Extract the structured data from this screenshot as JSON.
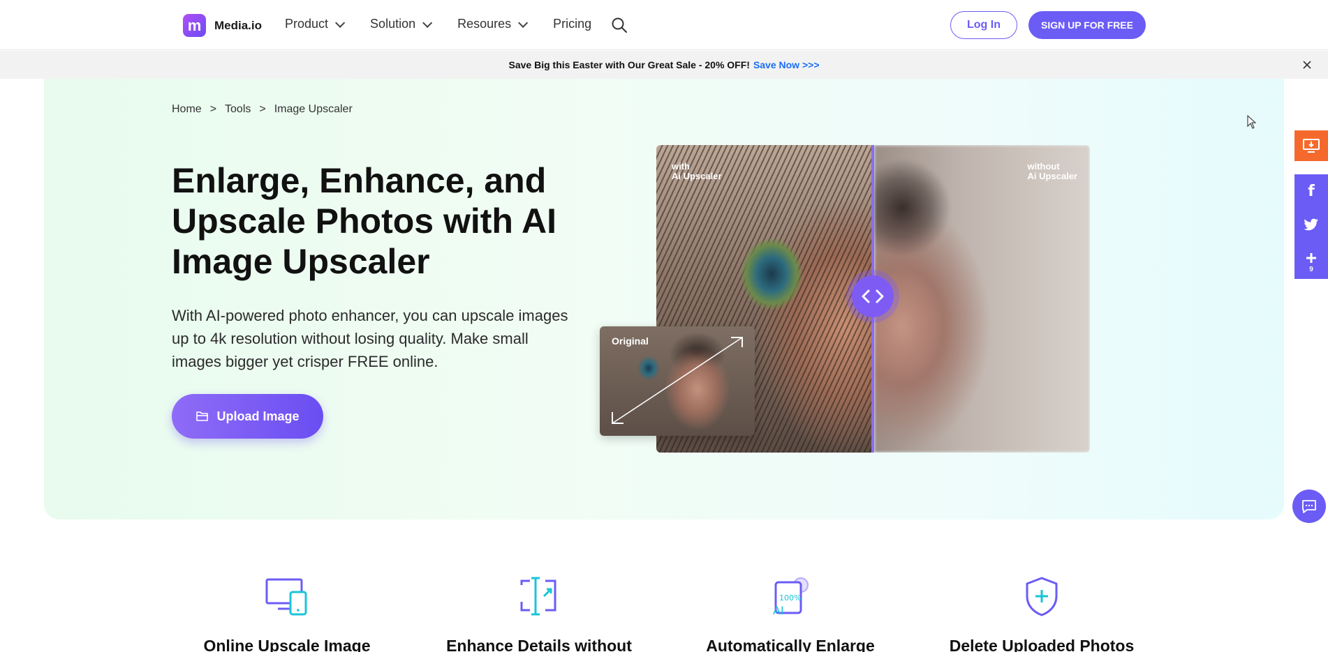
{
  "nav": {
    "logo_mark": "m",
    "logo_text": "Media.io",
    "items": [
      {
        "label": "Product"
      },
      {
        "label": "Solution"
      },
      {
        "label": "Resoures"
      },
      {
        "label": "Pricing"
      }
    ],
    "login_label": "Log In",
    "signup_label": "SIGN UP FOR FREE"
  },
  "promo": {
    "text": "Save Big this Easter with Our Great Sale - 20% OFF!",
    "link_label": "Save Now >>>"
  },
  "breadcrumb": [
    "Home",
    ">",
    "Tools",
    ">",
    "Image Upscaler"
  ],
  "hero": {
    "title": "Enlarge, Enhance, and Upscale Photos with AI Image Upscaler",
    "description": "With AI-powered photo enhancer, you can upscale images up to 4k resolution without losing quality. Make small images bigger yet crisper FREE online.",
    "upload_label": "Upload Image"
  },
  "compare": {
    "with_line1": "with",
    "with_line2": "Ai Upscaler",
    "without_line1": "without",
    "without_line2": "Ai Upscaler",
    "handle_glyph": "<>",
    "thumb_label": "Original"
  },
  "side": {
    "share_count": "9"
  },
  "features": [
    {
      "title": "Online Upscale Image",
      "icon": "devices-icon"
    },
    {
      "title": "Enhance Details without",
      "icon": "expand-icon"
    },
    {
      "title": "Automatically Enlarge",
      "icon": "ai-100-icon"
    },
    {
      "title": "Delete Uploaded Photos",
      "icon": "shield-plus-icon"
    }
  ],
  "colors": {
    "brand": "#6b5cf5",
    "promo_link": "#1a6ef5",
    "download_orange": "#f56a2c"
  }
}
